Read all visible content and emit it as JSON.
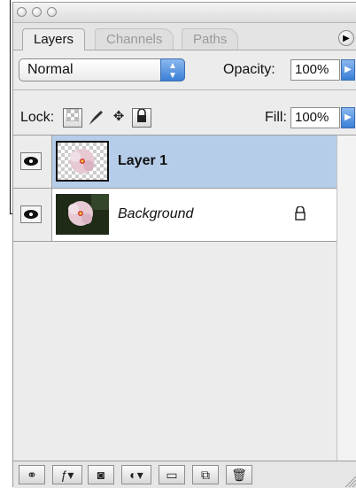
{
  "tabs": [
    {
      "label": "Layers",
      "active": true
    },
    {
      "label": "Channels",
      "active": false
    },
    {
      "label": "Paths",
      "active": false
    }
  ],
  "blend_mode": {
    "value": "Normal"
  },
  "opacity": {
    "label": "Opacity:",
    "value": "100%"
  },
  "lock": {
    "label": "Lock:"
  },
  "fill": {
    "label": "Fill:",
    "value": "100%"
  },
  "layers": [
    {
      "name": "Layer 1",
      "selected": true,
      "italic": false,
      "visible": true
    },
    {
      "name": "Background",
      "selected": false,
      "italic": true,
      "visible": true,
      "locked": true
    }
  ],
  "colors": {
    "selection": "#b6cdea",
    "accent": "#3a7fd6"
  }
}
